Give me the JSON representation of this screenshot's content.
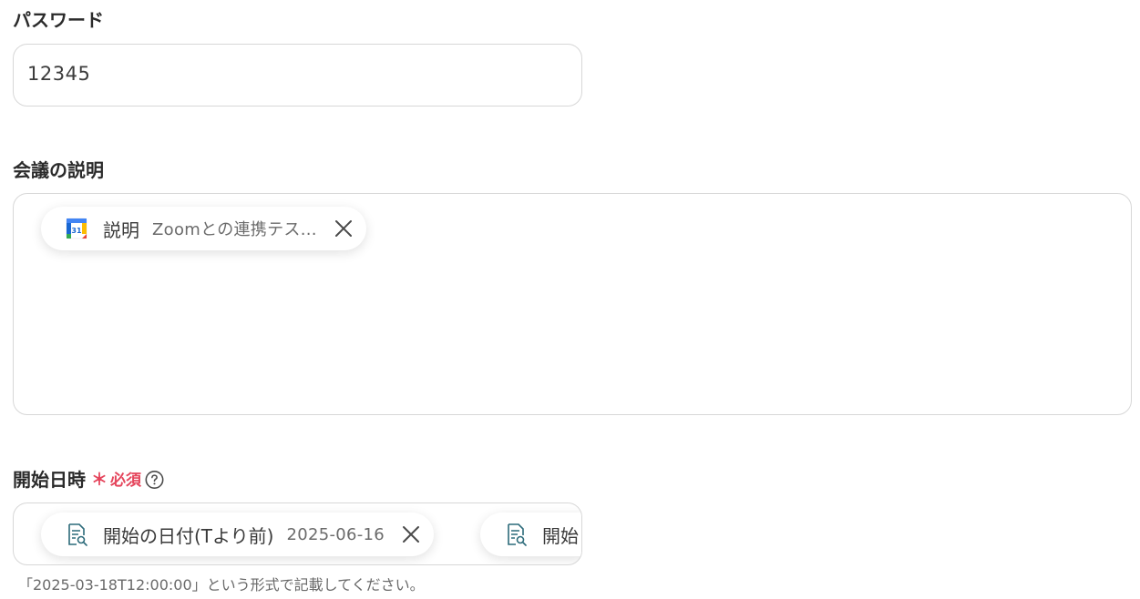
{
  "password": {
    "label": "パスワード",
    "value": "12345"
  },
  "description": {
    "label": "会議の説明",
    "chip": {
      "name": "説明",
      "value": "Zoomとの連携テス...",
      "icon": "google-calendar-icon",
      "icon_text": "31"
    }
  },
  "start_datetime": {
    "label": "開始日時",
    "required_mark": "＊",
    "required_text": "必須",
    "chips": [
      {
        "name": "開始の日付(Tより前)",
        "value": "2025-06-16",
        "icon": "document-search-icon"
      },
      {
        "name": "開始",
        "icon": "document-search-icon"
      }
    ],
    "hint": "「2025-03-18T12:00:00」という形式で記載してください。"
  },
  "colors": {
    "accent_red": "#e5455c",
    "border": "#d7d7d7",
    "icon_teal": "#2c6b7a"
  }
}
